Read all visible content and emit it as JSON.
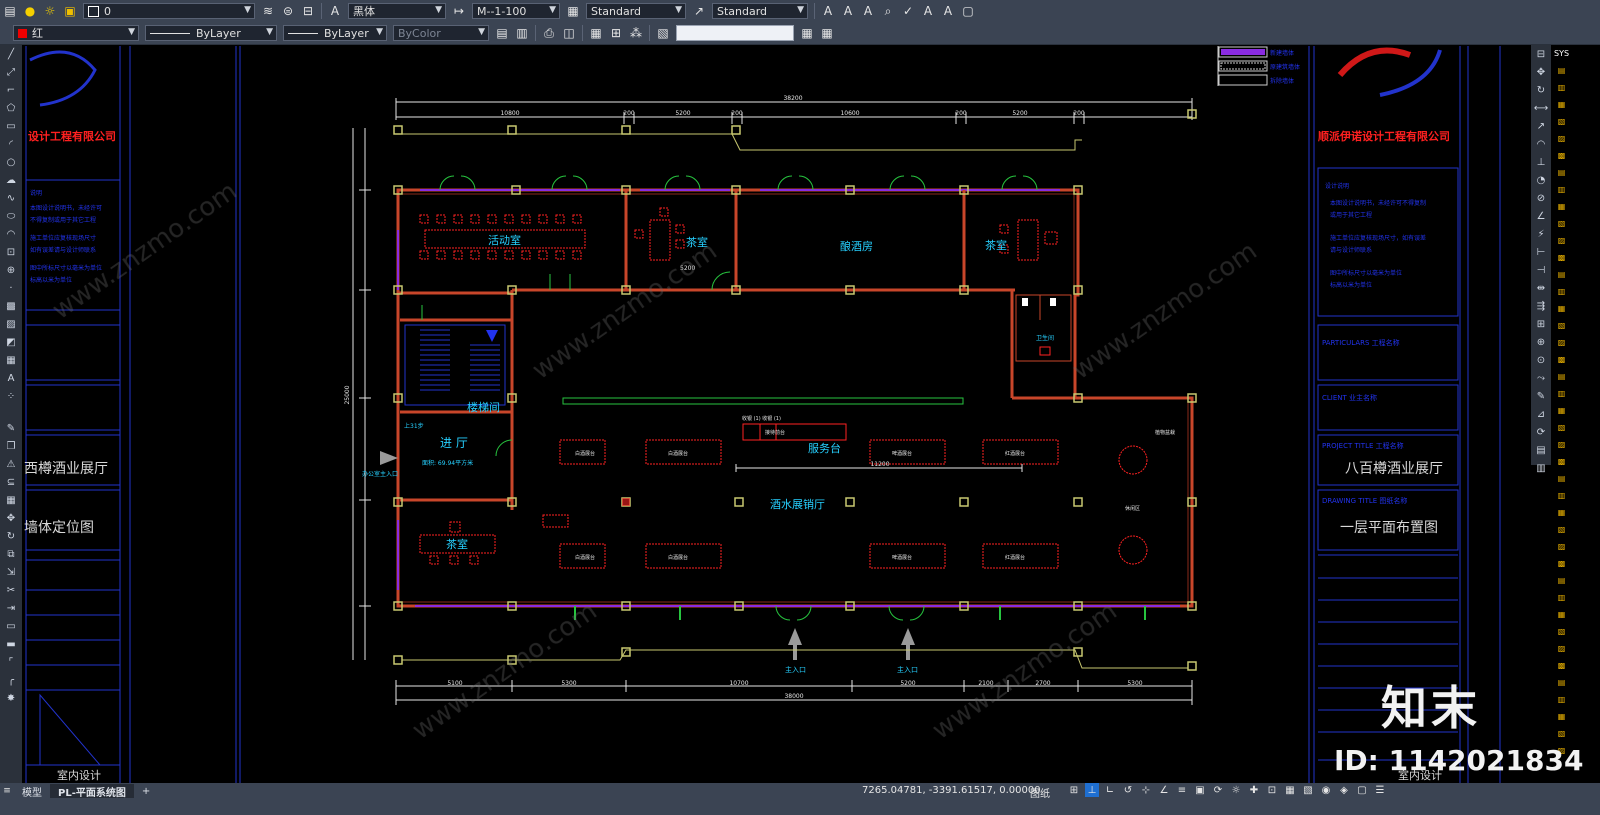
{
  "toolbar1": {
    "layer_value": "0",
    "text_style_font": "黑体",
    "dim_style_value": "M--1-100",
    "table_style_value": "Standard",
    "multileader_style_value": "Standard"
  },
  "toolbar2": {
    "color_value": "红",
    "linetype_value": "ByLayer",
    "lineweight_value": "ByLayer",
    "plotstyle_value": "ByColor"
  },
  "drawing": {
    "title_left": "西樽酒业展厅",
    "drawing_name_left": "墙体定位图",
    "title_right": "八百樽酒业展厅",
    "drawing_name_right": "一层平面布置图",
    "company_left": "设计工程有限公司",
    "company_right": "顺派伊诺设计工程有限公司",
    "design_footer": "室内设计",
    "design_footer_right": "室内设计",
    "rooms": {
      "activity": "活动室",
      "tea1": "茶室",
      "tea2": "茶室",
      "tea3": "茶室",
      "wine_room": "酿酒房",
      "stair": "楼梯间",
      "entry": "进 厅",
      "area": "面积: 69.94平方米",
      "service": "服务台",
      "hall": "酒水展销厅",
      "wc": "卫生间",
      "main_entry_a": "主入口",
      "main_entry_b": "主入口",
      "side_entry": "办公室主入口"
    },
    "dims_top": [
      "10800",
      "200",
      "5200",
      "200",
      "10600",
      "200",
      "5200",
      "200"
    ],
    "dim_total": "38200",
    "dims_bottom": [
      "5100",
      "5300",
      "10700",
      "5200",
      "2100",
      "2700",
      "5300"
    ],
    "dim_total_bottom": "38000",
    "dim_left_total": "25000",
    "dim_service": "11200",
    "dim_tea": "5200"
  },
  "tabs": {
    "model": "模型",
    "layout": "PL-平面系统图",
    "add": "+"
  },
  "status": {
    "coords": "7265.04781, -3391.61517, 0.00000",
    "paper": "图纸"
  },
  "watermark": {
    "brand": "知末",
    "id": "ID: 1142021834",
    "site": "www.znzmo.com"
  },
  "colors": {
    "wall": "#c8462a",
    "wall_fill": "#8a2a1a",
    "dim": "#e6e6e6",
    "text": "#26d0ff",
    "furniture": "#ff2222",
    "column": "#c8c870",
    "door": "#27c43f",
    "frame": "#2233cc",
    "ui_bg": "#3b4453"
  }
}
